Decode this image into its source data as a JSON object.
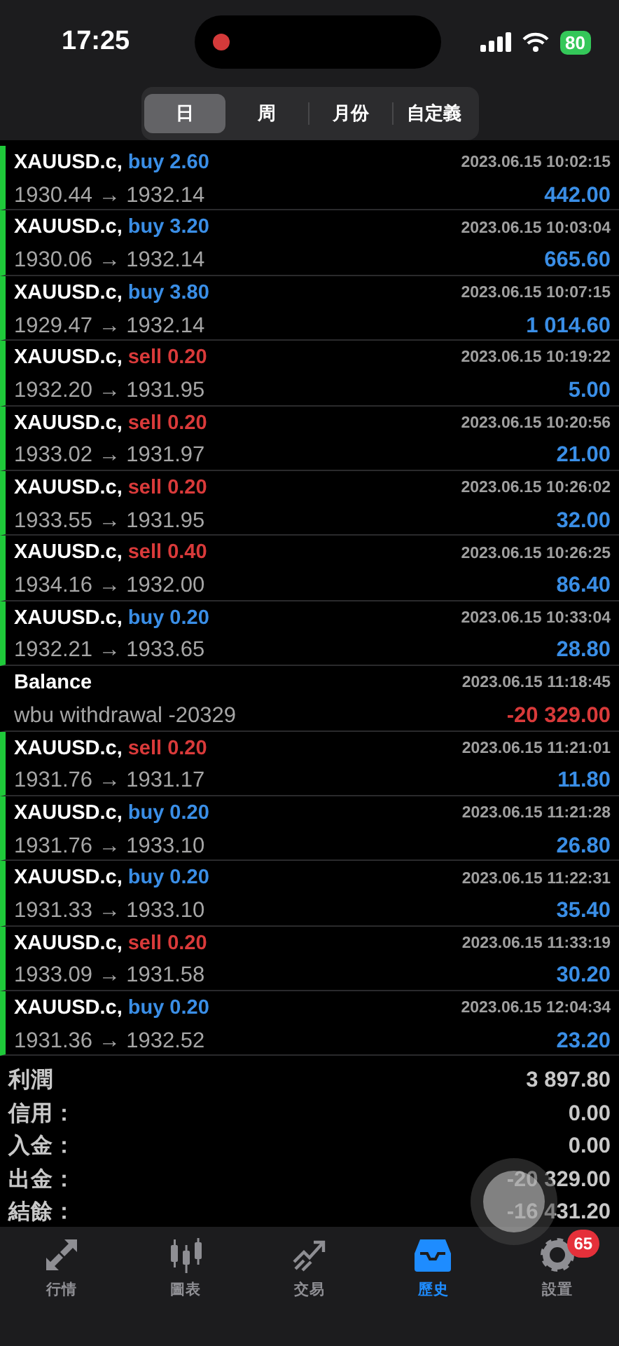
{
  "status_bar": {
    "time": "17:25",
    "battery": "80"
  },
  "segments": [
    {
      "label": "日",
      "selected": true
    },
    {
      "label": "周",
      "selected": false
    },
    {
      "label": "月份",
      "selected": false
    },
    {
      "label": "自定義",
      "selected": false
    }
  ],
  "rows": [
    {
      "kind": "buy",
      "symbol": "XAUUSD.c,",
      "action": "buy 2.60",
      "time": "2023.06.15 10:02:15",
      "prices": "1930.44 → 1932.14",
      "profit": "442.00",
      "negative": false
    },
    {
      "kind": "buy",
      "symbol": "XAUUSD.c,",
      "action": "buy 3.20",
      "time": "2023.06.15 10:03:04",
      "prices": "1930.06 → 1932.14",
      "profit": "665.60",
      "negative": false
    },
    {
      "kind": "buy",
      "symbol": "XAUUSD.c,",
      "action": "buy 3.80",
      "time": "2023.06.15 10:07:15",
      "prices": "1929.47 → 1932.14",
      "profit": "1 014.60",
      "negative": false
    },
    {
      "kind": "sell",
      "symbol": "XAUUSD.c,",
      "action": "sell 0.20",
      "time": "2023.06.15 10:19:22",
      "prices": "1932.20 → 1931.95",
      "profit": "5.00",
      "negative": false
    },
    {
      "kind": "sell",
      "symbol": "XAUUSD.c,",
      "action": "sell 0.20",
      "time": "2023.06.15 10:20:56",
      "prices": "1933.02 → 1931.97",
      "profit": "21.00",
      "negative": false
    },
    {
      "kind": "sell",
      "symbol": "XAUUSD.c,",
      "action": "sell 0.20",
      "time": "2023.06.15 10:26:02",
      "prices": "1933.55 → 1931.95",
      "profit": "32.00",
      "negative": false
    },
    {
      "kind": "sell",
      "symbol": "XAUUSD.c,",
      "action": "sell 0.40",
      "time": "2023.06.15 10:26:25",
      "prices": "1934.16 → 1932.00",
      "profit": "86.40",
      "negative": false
    },
    {
      "kind": "buy",
      "symbol": "XAUUSD.c,",
      "action": "buy 0.20",
      "time": "2023.06.15 10:33:04",
      "prices": "1932.21 → 1933.65",
      "profit": "28.80",
      "negative": false
    },
    {
      "kind": "balance",
      "symbol": "Balance",
      "time": "2023.06.15 11:18:45",
      "prices": "wbu withdrawal -20329",
      "profit": "-20 329.00",
      "negative": true
    },
    {
      "kind": "sell",
      "symbol": "XAUUSD.c,",
      "action": "sell 0.20",
      "time": "2023.06.15 11:21:01",
      "prices": "1931.76 → 1931.17",
      "profit": "11.80",
      "negative": false
    },
    {
      "kind": "buy",
      "symbol": "XAUUSD.c,",
      "action": "buy 0.20",
      "time": "2023.06.15 11:21:28",
      "prices": "1931.76 → 1933.10",
      "profit": "26.80",
      "negative": false
    },
    {
      "kind": "buy",
      "symbol": "XAUUSD.c,",
      "action": "buy 0.20",
      "time": "2023.06.15 11:22:31",
      "prices": "1931.33 → 1933.10",
      "profit": "35.40",
      "negative": false
    },
    {
      "kind": "sell",
      "symbol": "XAUUSD.c,",
      "action": "sell 0.20",
      "time": "2023.06.15 11:33:19",
      "prices": "1933.09 → 1931.58",
      "profit": "30.20",
      "negative": false
    },
    {
      "kind": "buy",
      "symbol": "XAUUSD.c,",
      "action": "buy 0.20",
      "time": "2023.06.15 12:04:34",
      "prices": "1931.36 → 1932.52",
      "profit": "23.20",
      "negative": false
    }
  ],
  "summary": [
    {
      "label": "利潤",
      "value": "3 897.80"
    },
    {
      "label": "信用：",
      "value": "0.00"
    },
    {
      "label": "入金：",
      "value": "0.00"
    },
    {
      "label": "出金：",
      "value": "-20 329.00"
    },
    {
      "label": "結餘：",
      "value": "-16 431.20"
    }
  ],
  "tabs": [
    {
      "label": "行情",
      "selected": false
    },
    {
      "label": "圖表",
      "selected": false
    },
    {
      "label": "交易",
      "selected": false
    },
    {
      "label": "歷史",
      "selected": true
    },
    {
      "label": "設置",
      "selected": false,
      "badge": "65"
    }
  ]
}
